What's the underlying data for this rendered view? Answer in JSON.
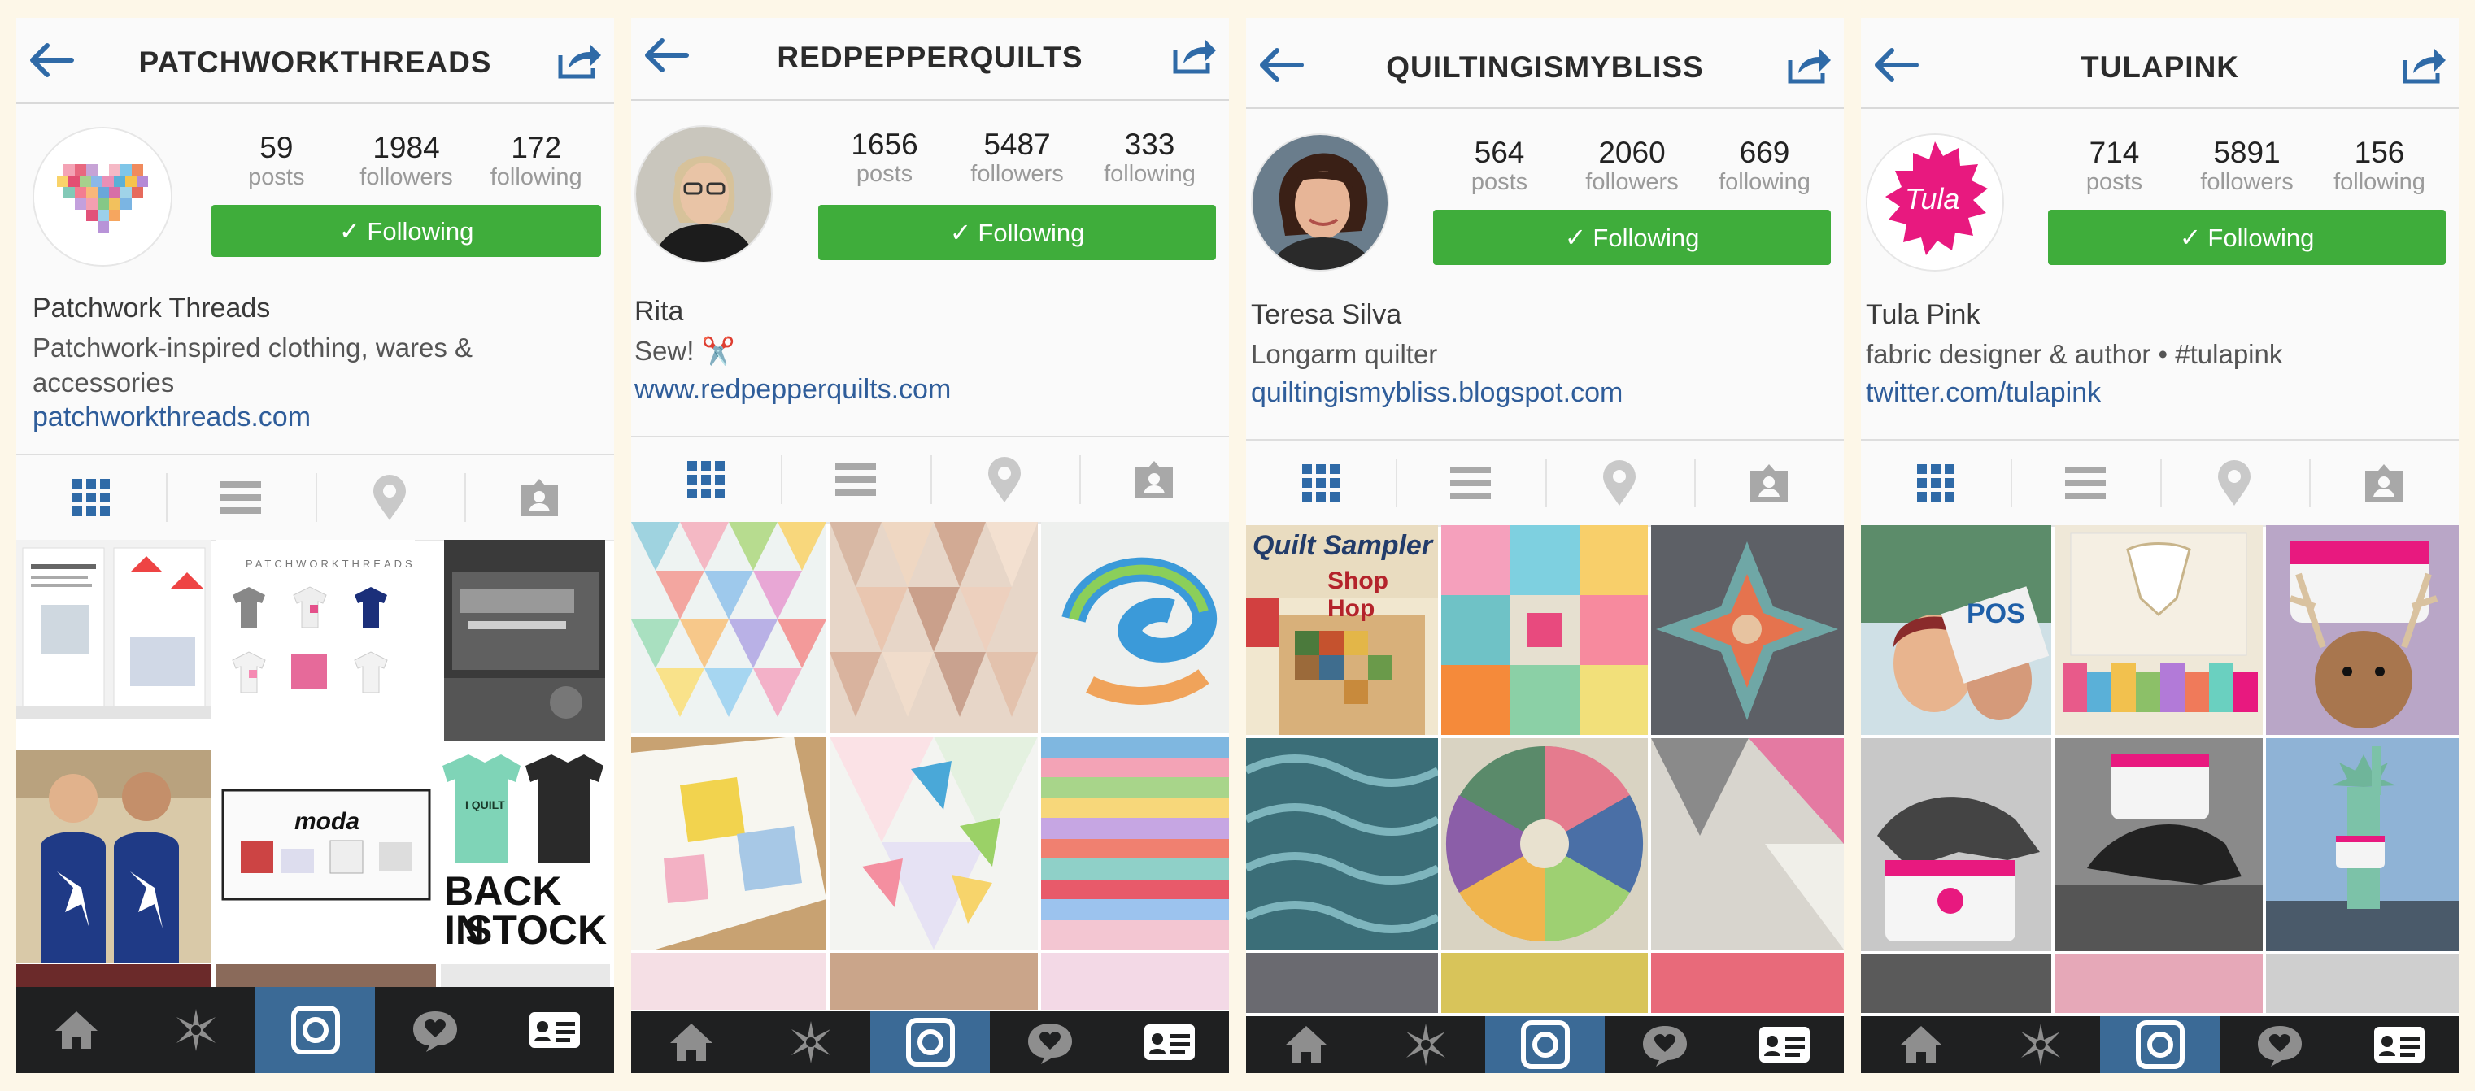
{
  "profiles": [
    {
      "username": "PATCHWORKTHREADS",
      "stats": {
        "posts": "59",
        "posts_label": "posts",
        "followers": "1984",
        "followers_label": "followers",
        "following": "172",
        "following_label": "following"
      },
      "follow_label": "Following",
      "name": "Patchwork Threads",
      "bio_lines": [
        "Patchwork-inspired clothing, wares &",
        "accessories"
      ],
      "link": "patchworkthreads.com",
      "grid_texts": {
        "brand": "PATCHWORKTHREADS",
        "back_in": "BACK IN",
        "stock": "STOCK",
        "moda": "moda",
        "tshirt": "I QUILT"
      }
    },
    {
      "username": "REDPEPPERQUILTS",
      "stats": {
        "posts": "1656",
        "posts_label": "posts",
        "followers": "5487",
        "followers_label": "followers",
        "following": "333",
        "following_label": "following"
      },
      "follow_label": "Following",
      "name": "Rita",
      "bio_lines": [
        "Sew! ✂️"
      ],
      "link": "www.redpepperquilts.com"
    },
    {
      "username": "QUILTINGISMYBLISS",
      "stats": {
        "posts": "564",
        "posts_label": "posts",
        "followers": "2060",
        "followers_label": "followers",
        "following": "669",
        "following_label": "following"
      },
      "follow_label": "Following",
      "name": "Teresa Silva",
      "bio_lines": [
        "Longarm quilter"
      ],
      "link": "quiltingismybliss.blogspot.com",
      "grid_texts": {
        "mag_title": "Quilt Sampler",
        "mag_sub": "Shop Hop"
      }
    },
    {
      "username": "TULAPINK",
      "stats": {
        "posts": "714",
        "posts_label": "posts",
        "followers": "5891",
        "followers_label": "followers",
        "following": "156",
        "following_label": "following"
      },
      "follow_label": "Following",
      "name": "Tula Pink",
      "bio_lines": [
        "fabric designer & author • #tulapink"
      ],
      "link": "twitter.com/tulapink",
      "grid_texts": {
        "logo": "Tula",
        "pos": "POS"
      }
    }
  ],
  "icons": {
    "back": "back-arrow-icon",
    "share": "share-icon",
    "tabs": [
      "grid-icon",
      "list-icon",
      "location-pin-icon",
      "tagged-photos-icon"
    ],
    "bottom": [
      "home-icon",
      "explore-icon",
      "camera-icon",
      "activity-icon",
      "profile-icon"
    ]
  },
  "colors": {
    "follow": "#3fad3b",
    "link": "#2f5d9a",
    "bottom_bar": "#1f2021",
    "bottom_active": "#3b6a96",
    "tab_active": "#2f6aa7",
    "tab_inactive": "#a8a8a8",
    "tula_pink": "#e8197f"
  }
}
